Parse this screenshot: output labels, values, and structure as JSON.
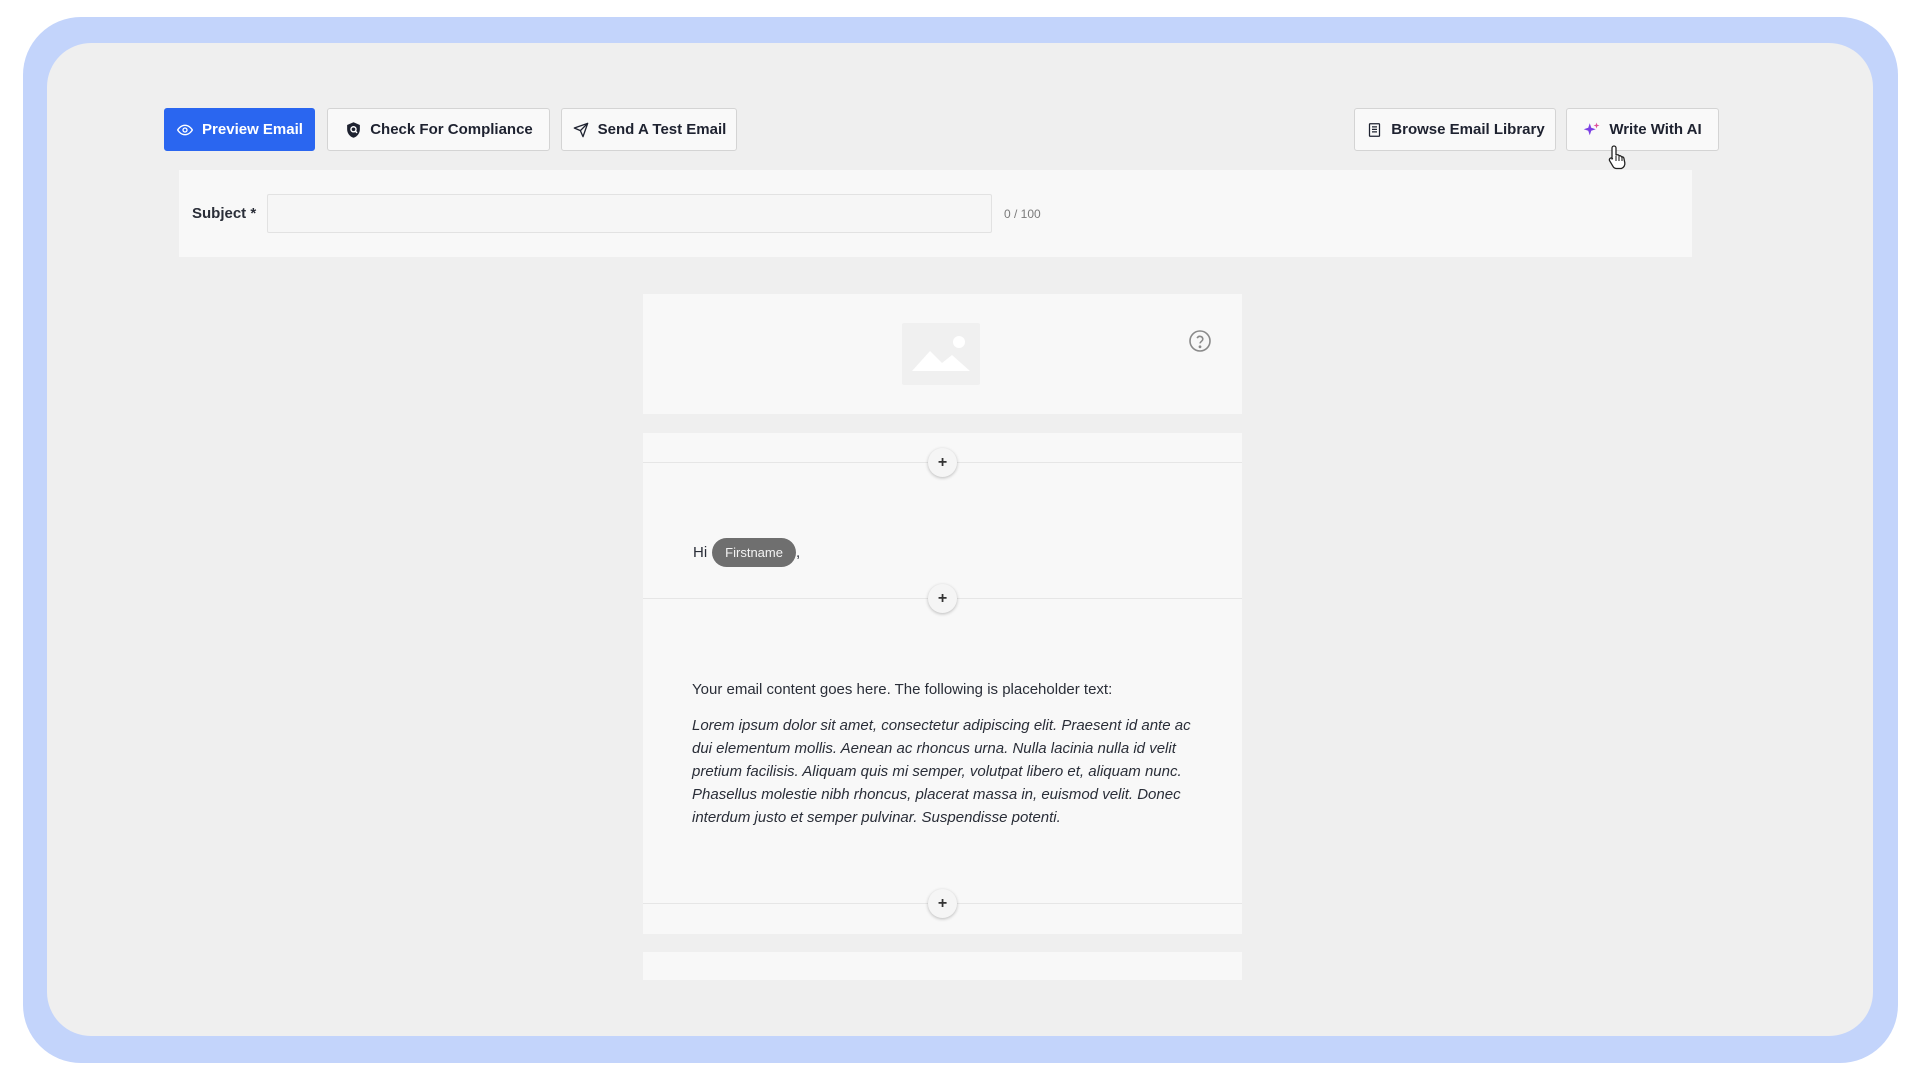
{
  "toolbar": {
    "preview_label": "Preview Email",
    "compliance_label": "Check For Compliance",
    "test_label": "Send A Test Email",
    "library_label": "Browse Email Library",
    "ai_label": "Write With AI"
  },
  "subject": {
    "label": "Subject *",
    "value": "",
    "count": "0 / 100"
  },
  "email": {
    "greeting_prefix": "Hi",
    "firstname_token": "Firstname",
    "greeting_suffix": ",",
    "add_symbol": "+",
    "intro": "Your email content goes here. The following is placeholder text:",
    "lorem": "Lorem ipsum dolor sit amet, consectetur adipiscing elit. Praesent id ante ac dui elementum mollis. Aenean ac rhoncus urna. Nulla lacinia nulla id velit pretium facilisis. Aliquam quis mi semper, volutpat libero et, aliquam nunc. Phasellus molestie nibh rhoncus, placerat massa in, euismod velit. Donec interdum justo et semper pulvinar. Suspendisse potenti."
  },
  "colors": {
    "primary": "#2a66f0",
    "frame": "#c3d4fb",
    "token": "#6f6f6f",
    "ai_sparkle": "#7b3fe4"
  },
  "icons": {
    "preview": "eye-icon",
    "compliance": "shield-icon",
    "test": "send-icon",
    "library": "book-icon",
    "ai": "sparkle-icon",
    "help": "question-circle-icon",
    "image": "image-placeholder-icon",
    "cursor": "hand-pointer-icon"
  }
}
